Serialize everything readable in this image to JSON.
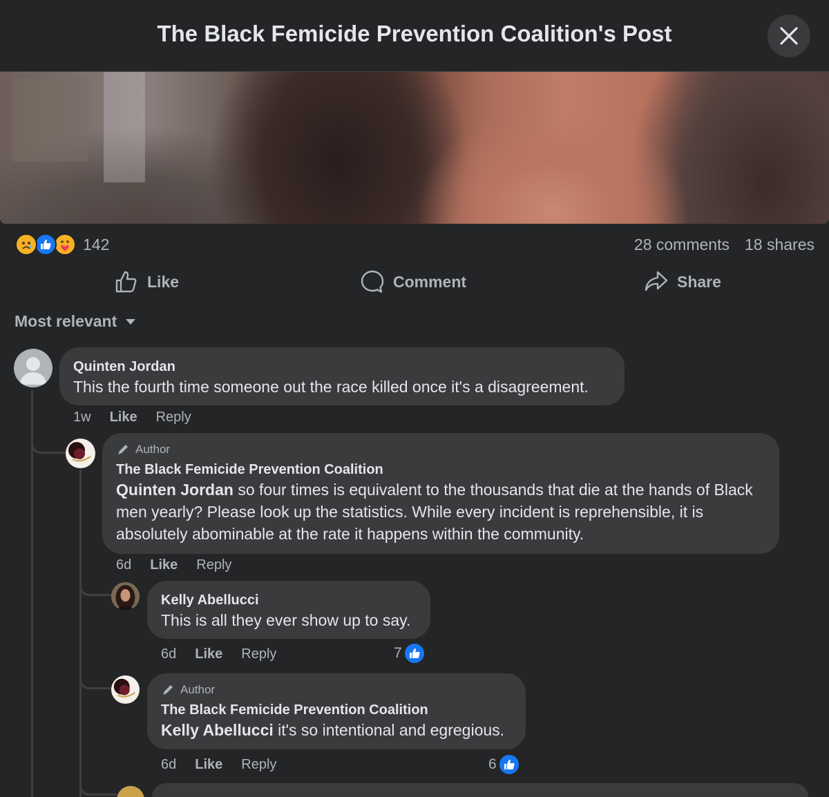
{
  "header": {
    "title": "The Black Femicide Prevention Coalition's Post",
    "close_icon": "close-icon"
  },
  "post": {
    "reaction_icons": [
      "sad-reaction-icon",
      "like-reaction-icon",
      "care-reaction-icon"
    ],
    "reaction_count": "142",
    "comments_count": "28 comments",
    "shares_count": "18 shares"
  },
  "actions": {
    "like": "Like",
    "comment": "Comment",
    "share": "Share"
  },
  "sort": {
    "label": "Most relevant"
  },
  "comments": [
    {
      "name": "Quinten Jordan",
      "text": "This the fourth time someone out the race killed once it's a disagreement.",
      "time": "1w",
      "like": "Like",
      "reply": "Reply"
    },
    {
      "author_tag": "Author",
      "name": "The Black Femicide Prevention Coalition",
      "mention": "Quinten Jordan",
      "text": " so four times is equivalent to the thousands that die at the hands of Black men yearly? Please look up the statistics. While every incident is reprehensible, it is absolutely abominable at the rate it happens within the community.",
      "time": "6d",
      "like": "Like",
      "reply": "Reply"
    },
    {
      "name": "Kelly Abellucci",
      "text": "This is all they ever show up to say.",
      "time": "6d",
      "like": "Like",
      "reply": "Reply",
      "likes": "7"
    },
    {
      "author_tag": "Author",
      "name": "The Black Femicide Prevention Coalition",
      "mention": "Kelly Abellucci",
      "text": " it's so intentional and egregious.",
      "time": "6d",
      "like": "Like",
      "reply": "Reply",
      "likes": "6"
    }
  ],
  "colors": {
    "background": "#242526",
    "bubble": "#3a3b3c",
    "secondary_text": "#b0b3b8",
    "accent": "#1877f2"
  }
}
